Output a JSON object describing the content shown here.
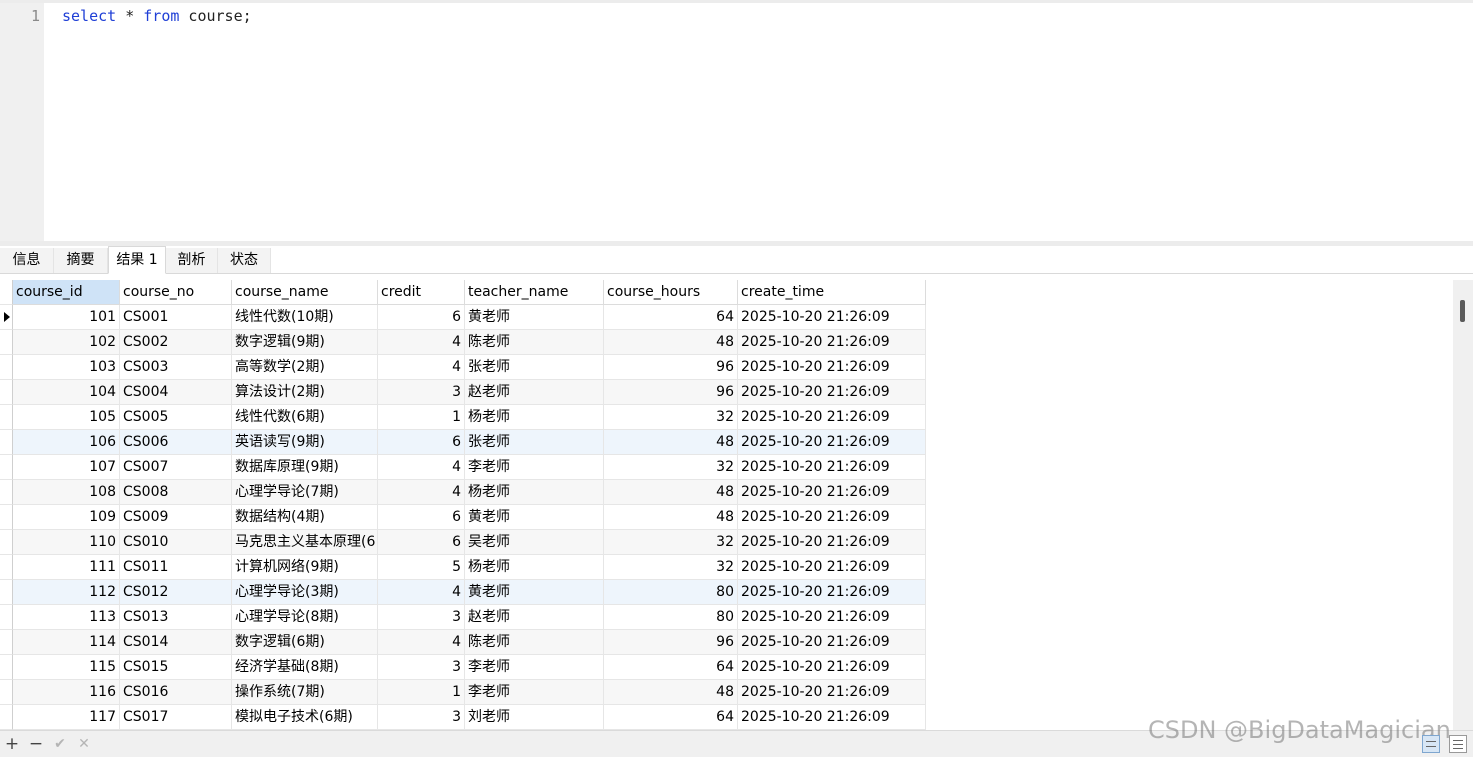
{
  "editor": {
    "line_number": "1",
    "sql_keyword_select": "select",
    "sql_star": " * ",
    "sql_keyword_from": "from",
    "sql_rest": " course;"
  },
  "tabs": [
    "信息",
    "摘要",
    "结果 1",
    "剖析",
    "状态"
  ],
  "active_tab": "结果 1",
  "grid": {
    "columns": [
      "course_id",
      "course_no",
      "course_name",
      "credit",
      "teacher_name",
      "course_hours",
      "create_time"
    ],
    "rows": [
      [
        "101",
        "CS001",
        "线性代数(10期)",
        "6",
        "黄老师",
        "64",
        "2025-10-20 21:26:09"
      ],
      [
        "102",
        "CS002",
        "数字逻辑(9期)",
        "4",
        "陈老师",
        "48",
        "2025-10-20 21:26:09"
      ],
      [
        "103",
        "CS003",
        "高等数学(2期)",
        "4",
        "张老师",
        "96",
        "2025-10-20 21:26:09"
      ],
      [
        "104",
        "CS004",
        "算法设计(2期)",
        "3",
        "赵老师",
        "96",
        "2025-10-20 21:26:09"
      ],
      [
        "105",
        "CS005",
        "线性代数(6期)",
        "1",
        "杨老师",
        "32",
        "2025-10-20 21:26:09"
      ],
      [
        "106",
        "CS006",
        "英语读写(9期)",
        "6",
        "张老师",
        "48",
        "2025-10-20 21:26:09"
      ],
      [
        "107",
        "CS007",
        "数据库原理(9期)",
        "4",
        "李老师",
        "32",
        "2025-10-20 21:26:09"
      ],
      [
        "108",
        "CS008",
        "心理学导论(7期)",
        "4",
        "杨老师",
        "48",
        "2025-10-20 21:26:09"
      ],
      [
        "109",
        "CS009",
        "数据结构(4期)",
        "6",
        "黄老师",
        "48",
        "2025-10-20 21:26:09"
      ],
      [
        "110",
        "CS010",
        "马克思主义基本原理(6",
        "6",
        "吴老师",
        "32",
        "2025-10-20 21:26:09"
      ],
      [
        "111",
        "CS011",
        "计算机网络(9期)",
        "5",
        "杨老师",
        "32",
        "2025-10-20 21:26:09"
      ],
      [
        "112",
        "CS012",
        "心理学导论(3期)",
        "4",
        "黄老师",
        "80",
        "2025-10-20 21:26:09"
      ],
      [
        "113",
        "CS013",
        "心理学导论(8期)",
        "3",
        "赵老师",
        "80",
        "2025-10-20 21:26:09"
      ],
      [
        "114",
        "CS014",
        "数字逻辑(6期)",
        "4",
        "陈老师",
        "96",
        "2025-10-20 21:26:09"
      ],
      [
        "115",
        "CS015",
        "经济学基础(8期)",
        "3",
        "李老师",
        "64",
        "2025-10-20 21:26:09"
      ],
      [
        "116",
        "CS016",
        "操作系统(7期)",
        "1",
        "李老师",
        "48",
        "2025-10-20 21:26:09"
      ],
      [
        "117",
        "CS017",
        "模拟电子技术(6期)",
        "3",
        "刘老师",
        "64",
        "2025-10-20 21:26:09"
      ]
    ]
  },
  "toolbar": {
    "add": "+",
    "remove": "−",
    "apply": "✔",
    "discard": "✕"
  },
  "watermark": "CSDN @BigDataMagician"
}
